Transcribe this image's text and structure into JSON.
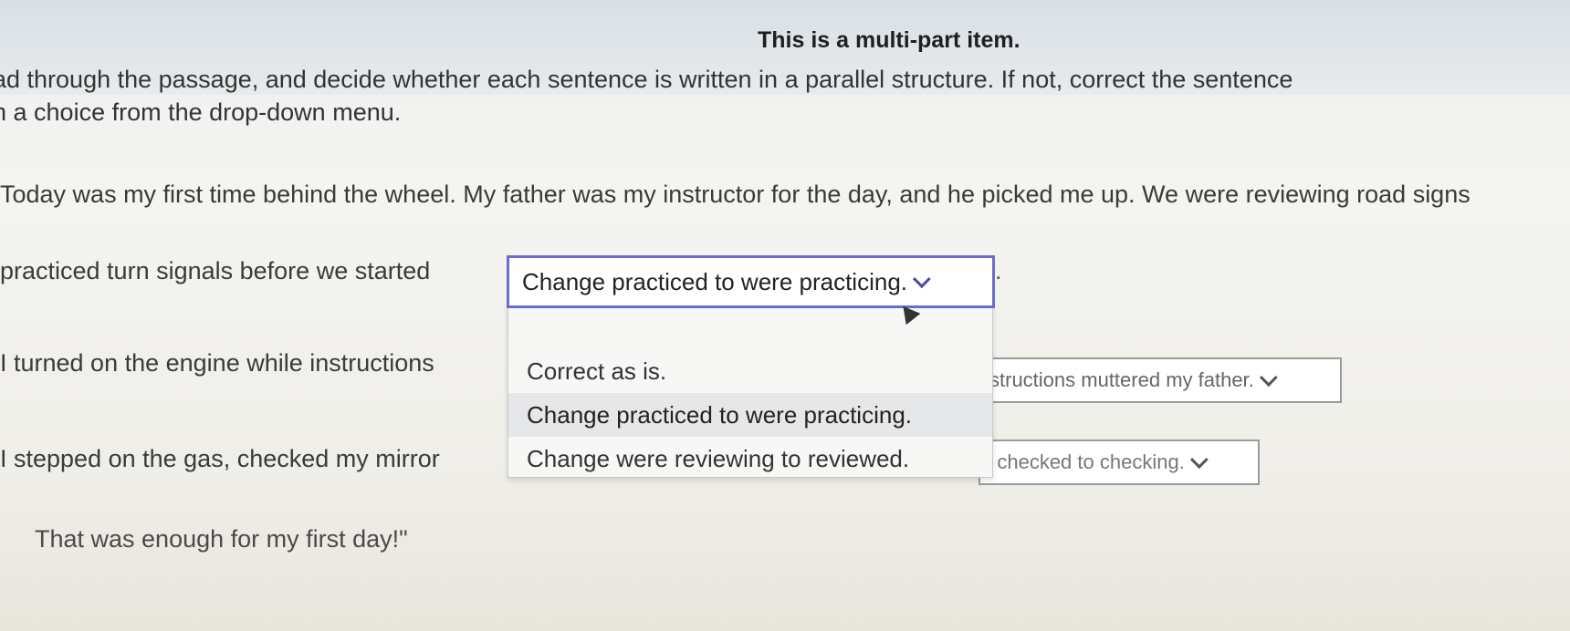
{
  "title": "This is a multi-part item.",
  "instructions": {
    "line1": "ad through the passage, and decide whether each sentence is written in a parallel structure. If not, correct the sentence",
    "line2": "h a choice from the drop-down menu."
  },
  "passage": {
    "p1": "Today was my first time behind the wheel. My father was my instructor for the day, and he picked me up. We were reviewing road signs",
    "p2": "practiced turn signals before we started",
    "p2_end": ".",
    "p3": "I turned on the engine while instructions",
    "p4": "I stepped on the gas, checked my mirror",
    "p5": "That was enough for my first day!\""
  },
  "dropdowns": {
    "d1": {
      "selected": "Change practiced to were practicing.",
      "options": [
        "Correct as is.",
        "Change practiced to were practicing.",
        "Change were reviewing to reviewed."
      ],
      "highlighted": "Change practiced to were practicing."
    },
    "d2": {
      "selected": "structions muttered my father."
    },
    "d3": {
      "selected": "e checked to checking."
    }
  },
  "icons": {
    "chevron": "chevron-down-icon",
    "cursor": "mouse-cursor-icon"
  },
  "colors": {
    "active_border": "#6d6bcb",
    "highlight": "#e6e7e9"
  }
}
